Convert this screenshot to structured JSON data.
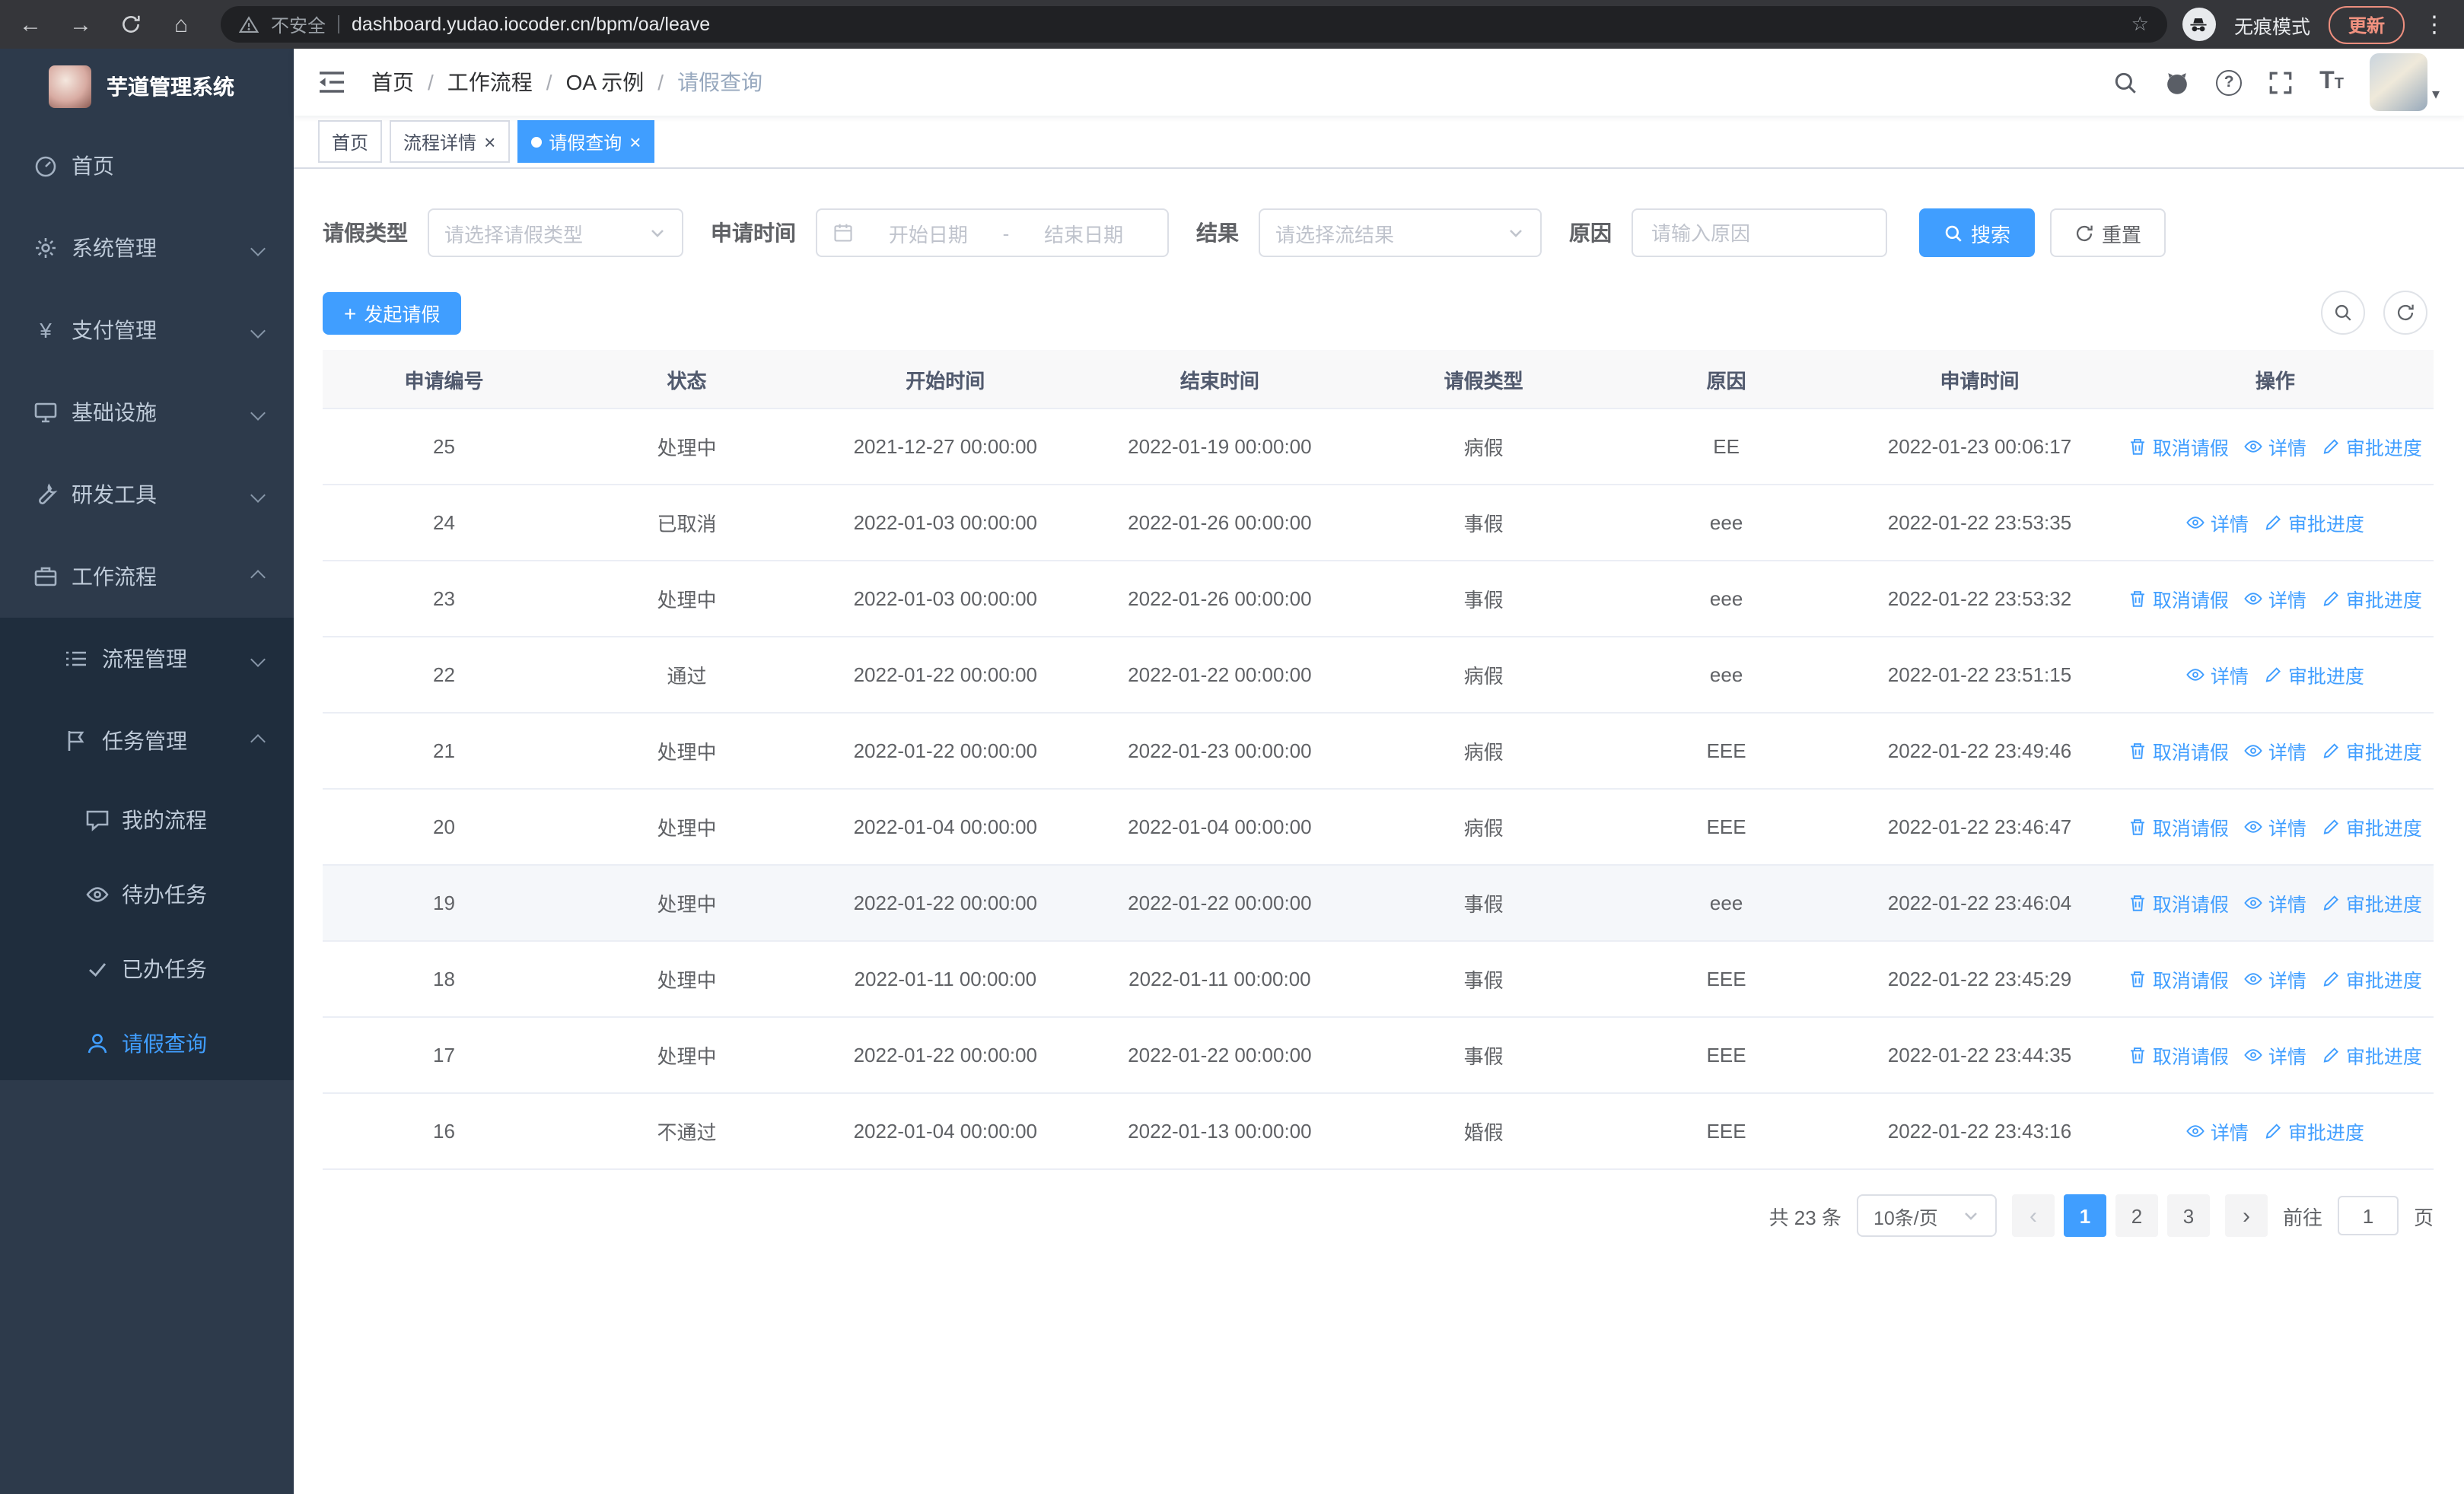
{
  "colors": {
    "accent": "#409eff",
    "sidebar_bg": "#2d3a4b",
    "submenu_bg": "#1f2d3d",
    "sidebar_text": "#bfcbd9",
    "update_chip": "#f0917f"
  },
  "browser": {
    "security_label": "不安全",
    "url": "dashboard.yudao.iocoder.cn/bpm/oa/leave",
    "incognito_label": "无痕模式",
    "update_label": "更新"
  },
  "sidebar": {
    "title": "芋道管理系统",
    "items": [
      {
        "label": "首页"
      },
      {
        "label": "系统管理"
      },
      {
        "label": "支付管理"
      },
      {
        "label": "基础设施"
      },
      {
        "label": "研发工具"
      },
      {
        "label": "工作流程"
      }
    ],
    "workflow_children": [
      {
        "label": "流程管理"
      },
      {
        "label": "任务管理"
      }
    ],
    "task_children": [
      {
        "label": "我的流程"
      },
      {
        "label": "待办任务"
      },
      {
        "label": "已办任务"
      },
      {
        "label": "请假查询"
      }
    ]
  },
  "navbar": {
    "breadcrumb": [
      "首页",
      "工作流程",
      "OA 示例",
      "请假查询"
    ]
  },
  "tabs": [
    {
      "label": "首页"
    },
    {
      "label": "流程详情"
    },
    {
      "label": "请假查询"
    }
  ],
  "filters": {
    "leave_type": {
      "label": "请假类型",
      "placeholder": "请选择请假类型"
    },
    "apply_time": {
      "label": "申请时间",
      "start_placeholder": "开始日期",
      "separator": "-",
      "end_placeholder": "结束日期"
    },
    "result": {
      "label": "结果",
      "placeholder": "请选择流结果"
    },
    "reason": {
      "label": "原因",
      "placeholder": "请输入原因"
    },
    "search_label": "搜索",
    "reset_label": "重置"
  },
  "toolbar": {
    "create_label": "发起请假"
  },
  "table": {
    "columns": [
      "申请编号",
      "状态",
      "开始时间",
      "结束时间",
      "请假类型",
      "原因",
      "申请时间",
      "操作"
    ],
    "action_labels": {
      "cancel": "取消请假",
      "detail": "详情",
      "progress": "审批进度"
    },
    "rows": [
      {
        "id": "25",
        "status": "处理中",
        "start": "2021-12-27 00:00:00",
        "end": "2022-01-19 00:00:00",
        "type": "病假",
        "reason": "EE",
        "applied": "2022-01-23 00:06:17",
        "actions": [
          "cancel",
          "detail",
          "progress"
        ]
      },
      {
        "id": "24",
        "status": "已取消",
        "start": "2022-01-03 00:00:00",
        "end": "2022-01-26 00:00:00",
        "type": "事假",
        "reason": "eee",
        "applied": "2022-01-22 23:53:35",
        "actions": [
          "detail",
          "progress"
        ]
      },
      {
        "id": "23",
        "status": "处理中",
        "start": "2022-01-03 00:00:00",
        "end": "2022-01-26 00:00:00",
        "type": "事假",
        "reason": "eee",
        "applied": "2022-01-22 23:53:32",
        "actions": [
          "cancel",
          "detail",
          "progress"
        ]
      },
      {
        "id": "22",
        "status": "通过",
        "start": "2022-01-22 00:00:00",
        "end": "2022-01-22 00:00:00",
        "type": "病假",
        "reason": "eee",
        "applied": "2022-01-22 23:51:15",
        "actions": [
          "detail",
          "progress"
        ]
      },
      {
        "id": "21",
        "status": "处理中",
        "start": "2022-01-22 00:00:00",
        "end": "2022-01-23 00:00:00",
        "type": "病假",
        "reason": "EEE",
        "applied": "2022-01-22 23:49:46",
        "actions": [
          "cancel",
          "detail",
          "progress"
        ]
      },
      {
        "id": "20",
        "status": "处理中",
        "start": "2022-01-04 00:00:00",
        "end": "2022-01-04 00:00:00",
        "type": "病假",
        "reason": "EEE",
        "applied": "2022-01-22 23:46:47",
        "actions": [
          "cancel",
          "detail",
          "progress"
        ]
      },
      {
        "id": "19",
        "status": "处理中",
        "start": "2022-01-22 00:00:00",
        "end": "2022-01-22 00:00:00",
        "type": "事假",
        "reason": "eee",
        "applied": "2022-01-22 23:46:04",
        "actions": [
          "cancel",
          "detail",
          "progress"
        ],
        "highlighted": true
      },
      {
        "id": "18",
        "status": "处理中",
        "start": "2022-01-11 00:00:00",
        "end": "2022-01-11 00:00:00",
        "type": "事假",
        "reason": "EEE",
        "applied": "2022-01-22 23:45:29",
        "actions": [
          "cancel",
          "detail",
          "progress"
        ]
      },
      {
        "id": "17",
        "status": "处理中",
        "start": "2022-01-22 00:00:00",
        "end": "2022-01-22 00:00:00",
        "type": "事假",
        "reason": "EEE",
        "applied": "2022-01-22 23:44:35",
        "actions": [
          "cancel",
          "detail",
          "progress"
        ]
      },
      {
        "id": "16",
        "status": "不通过",
        "start": "2022-01-04 00:00:00",
        "end": "2022-01-13 00:00:00",
        "type": "婚假",
        "reason": "EEE",
        "applied": "2022-01-22 23:43:16",
        "actions": [
          "detail",
          "progress"
        ]
      }
    ]
  },
  "pagination": {
    "total_label": "共 23 条",
    "page_size_label": "10条/页",
    "pages": [
      "1",
      "2",
      "3"
    ],
    "goto_label": "前往",
    "goto_value": "1",
    "goto_unit": "页"
  }
}
